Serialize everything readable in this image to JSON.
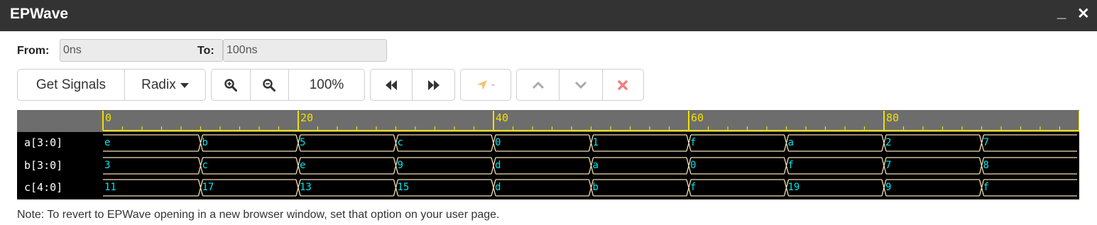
{
  "window": {
    "title": "EPWave",
    "minimize_glyph": "_",
    "close_glyph": "✕"
  },
  "range": {
    "from_label": "From:",
    "from_value": "0ns",
    "to_label": "To:",
    "to_value": "100ns"
  },
  "toolbar": {
    "get_signals": "Get Signals",
    "radix": "Radix",
    "zoom_level": "100%",
    "cursor_value": "-",
    "icons": [
      "zoom-in-icon",
      "zoom-out-icon",
      "rewind-icon",
      "fast-forward-icon",
      "cursor-arrow-icon",
      "chevron-up-icon",
      "chevron-down-icon",
      "delete-icon"
    ],
    "colors": {
      "cursor_arrow": "#f5c16c",
      "delete": "#f08080",
      "disabled_chevron": "#aaaaaa"
    }
  },
  "timeline": {
    "start": 0,
    "end": 100,
    "major_labels": [
      "0",
      "20",
      "40",
      "60",
      "80"
    ],
    "colors": {
      "ruler_bg": "#6d6d6d",
      "ruler_fg": "#f0e000",
      "wave_bg": "#000000",
      "trace": "#f5deb3",
      "value": "#00e5ee"
    }
  },
  "signals": [
    {
      "name": "a[3:0]",
      "segments": [
        {
          "t": 0,
          "v": "e"
        },
        {
          "t": 10,
          "v": "b"
        },
        {
          "t": 20,
          "v": "5"
        },
        {
          "t": 30,
          "v": "c"
        },
        {
          "t": 40,
          "v": "0"
        },
        {
          "t": 50,
          "v": "1"
        },
        {
          "t": 60,
          "v": "f"
        },
        {
          "t": 70,
          "v": "a"
        },
        {
          "t": 80,
          "v": "2"
        },
        {
          "t": 90,
          "v": "7"
        }
      ]
    },
    {
      "name": "b[3:0]",
      "segments": [
        {
          "t": 0,
          "v": "3"
        },
        {
          "t": 10,
          "v": "c"
        },
        {
          "t": 20,
          "v": "e"
        },
        {
          "t": 30,
          "v": "9"
        },
        {
          "t": 40,
          "v": "d"
        },
        {
          "t": 50,
          "v": "a"
        },
        {
          "t": 60,
          "v": "0"
        },
        {
          "t": 70,
          "v": "f"
        },
        {
          "t": 80,
          "v": "7"
        },
        {
          "t": 90,
          "v": "8"
        }
      ]
    },
    {
      "name": "c[4:0]",
      "segments": [
        {
          "t": 0,
          "v": "11"
        },
        {
          "t": 10,
          "v": "17"
        },
        {
          "t": 20,
          "v": "13"
        },
        {
          "t": 30,
          "v": "15"
        },
        {
          "t": 40,
          "v": "d"
        },
        {
          "t": 50,
          "v": "b"
        },
        {
          "t": 60,
          "v": "f"
        },
        {
          "t": 70,
          "v": "19"
        },
        {
          "t": 80,
          "v": "9"
        },
        {
          "t": 90,
          "v": "f"
        }
      ]
    }
  ],
  "note": "Note: To revert to EPWave opening in a new browser window, set that option on your user page."
}
